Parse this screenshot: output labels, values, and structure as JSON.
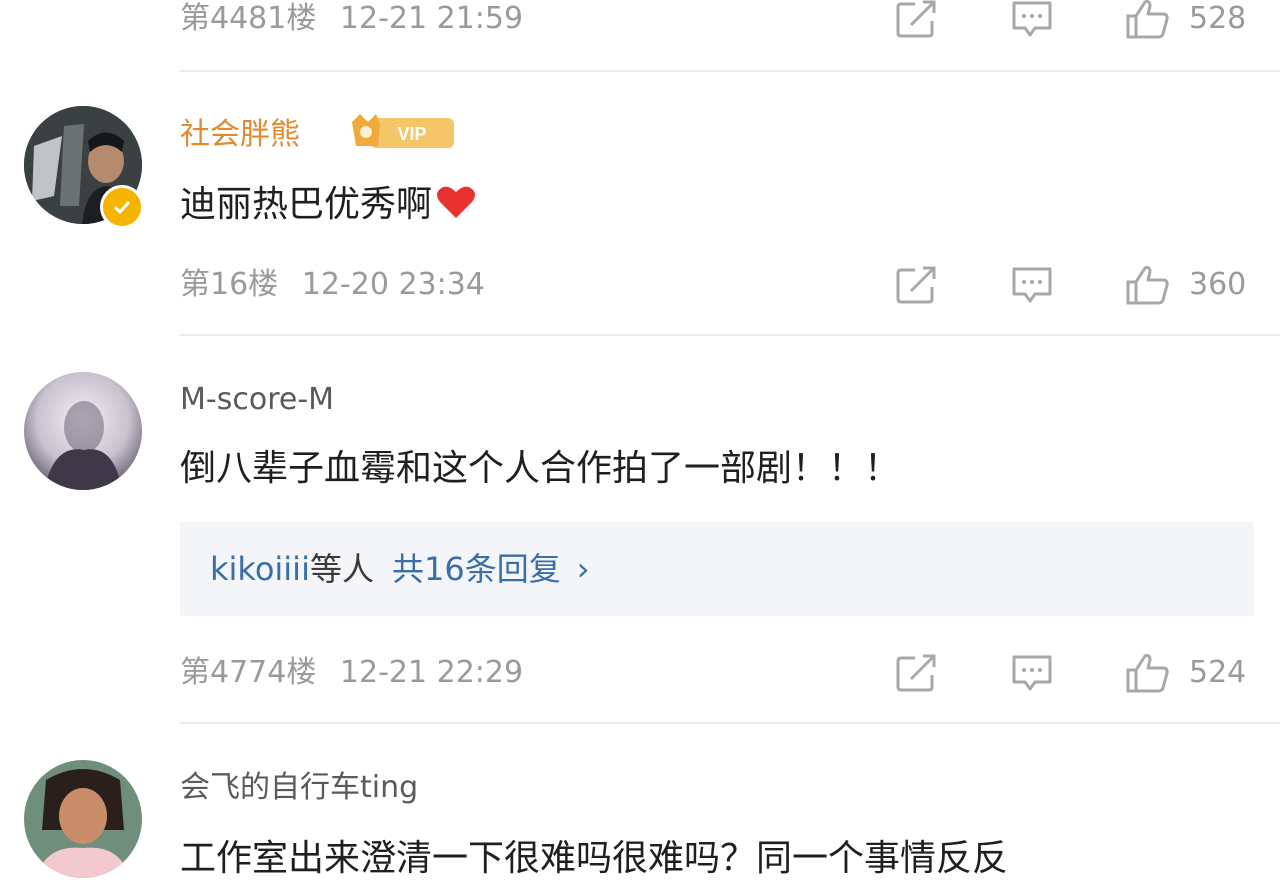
{
  "comments": [
    {
      "floor": "第4481楼",
      "time": "12-21 21:59",
      "likes": "528"
    },
    {
      "username": "社会胖熊",
      "vip_label": "VIP",
      "content": "迪丽热巴优秀啊",
      "emoji": "heart",
      "floor": "第16楼",
      "time": "12-20 23:34",
      "likes": "360"
    },
    {
      "username": "M-score-M",
      "content": "倒八辈子血霉和这个人合作拍了一部剧！！！",
      "replies": {
        "users": "kikoiiii",
        "users_suffix": "等人",
        "count_text": "共16条回复",
        "chevron": "›"
      },
      "floor": "第4774楼",
      "time": "12-21 22:29",
      "likes": "524"
    },
    {
      "username": "会飞的自行车ting",
      "content": "工作室出来澄清一下很难吗很难吗？同一个事情反反"
    }
  ],
  "colors": {
    "username_vip": "#e08a2c",
    "username_normal": "#5a5a5a",
    "meta": "#9a9a9a",
    "link": "#3a6ea5",
    "heart": "#e8322f",
    "verified": "#f4b400"
  },
  "icons": [
    "share-icon",
    "comment-icon",
    "like-icon",
    "heart-icon",
    "verified-icon",
    "vip-badge-icon"
  ]
}
